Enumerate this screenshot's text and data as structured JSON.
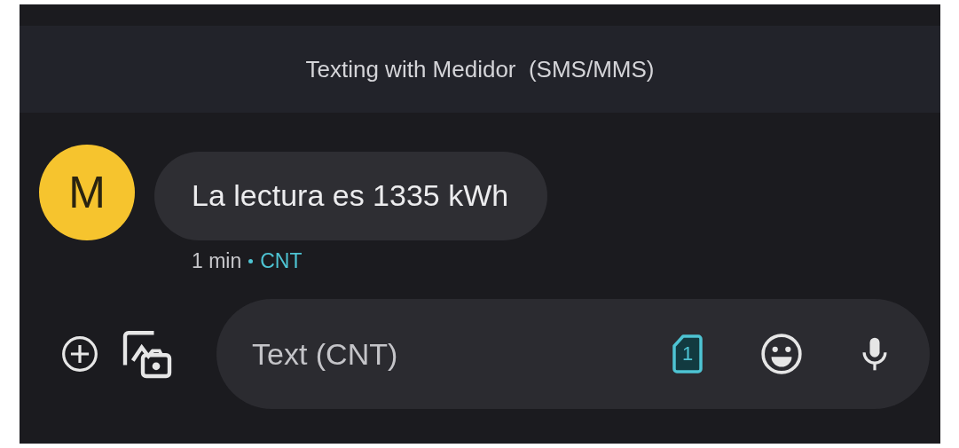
{
  "header": {
    "title": "Texting with Medidor  (SMS/MMS)"
  },
  "messages": [
    {
      "avatar_letter": "M",
      "color": "#f6c42e",
      "text": "La lectura es 1335 kWh",
      "time": "1 min",
      "sim": "CNT"
    }
  ],
  "composer": {
    "placeholder": "Text (CNT)",
    "sim_number": "1"
  }
}
